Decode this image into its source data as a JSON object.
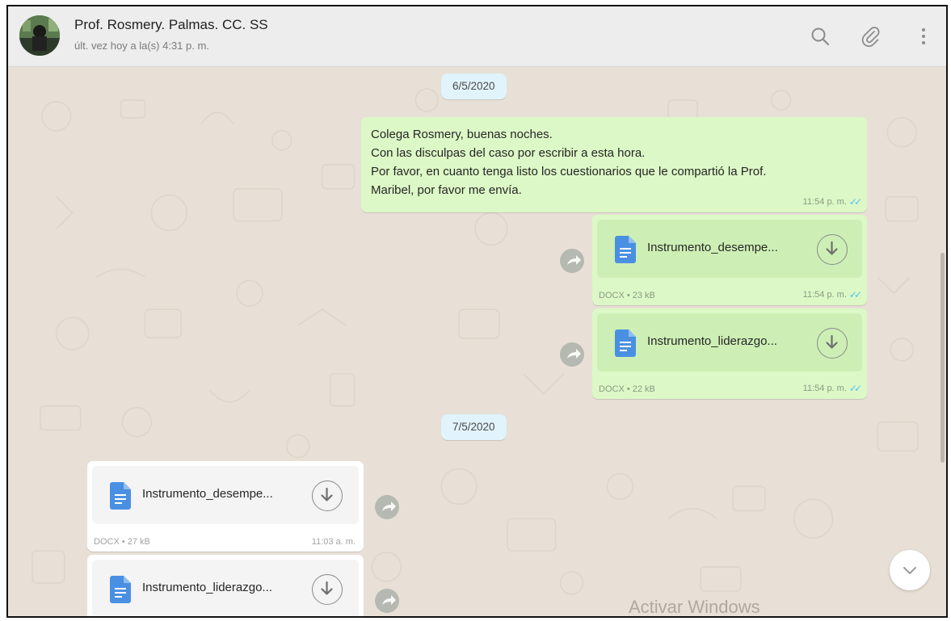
{
  "header": {
    "contact_name": "Prof. Rosmery. Palmas. CC. SS",
    "status": "últ. vez hoy a la(s) 4:31 p. m.",
    "icons": [
      "search-icon",
      "attach-icon",
      "menu-icon"
    ]
  },
  "dates": [
    "6/5/2020",
    "7/5/2020"
  ],
  "messages": {
    "text1": {
      "lines": [
        "Colega Rosmery, buenas noches.",
        "Con las disculpas del caso por escribir a esta hora.",
        "Por favor, en cuanto tenga listo los cuestionarios que le compartió la Prof.",
        "Maribel, por favor me envía."
      ],
      "time": "11:54 p. m."
    },
    "doc1": {
      "name": "Instrumento_desempe...",
      "meta": "DOCX • 23 kB",
      "time": "11:54 p. m."
    },
    "doc2": {
      "name": "Instrumento_liderazgo...",
      "meta": "DOCX • 22 kB",
      "time": "11:54 p. m."
    },
    "doc3": {
      "name": "Instrumento_desempe...",
      "meta": "DOCX • 27 kB",
      "time": "11:03 a. m."
    },
    "doc4": {
      "name": "Instrumento_liderazgo..."
    }
  },
  "watermark": "Activar Windows",
  "colors": {
    "outgoing_bubble": "#dcf8c6",
    "incoming_bubble": "#ffffff",
    "date_pill": "#e1f3fb",
    "read_ticks": "#4fc3f7",
    "doc_icon": "#4a90e2"
  }
}
